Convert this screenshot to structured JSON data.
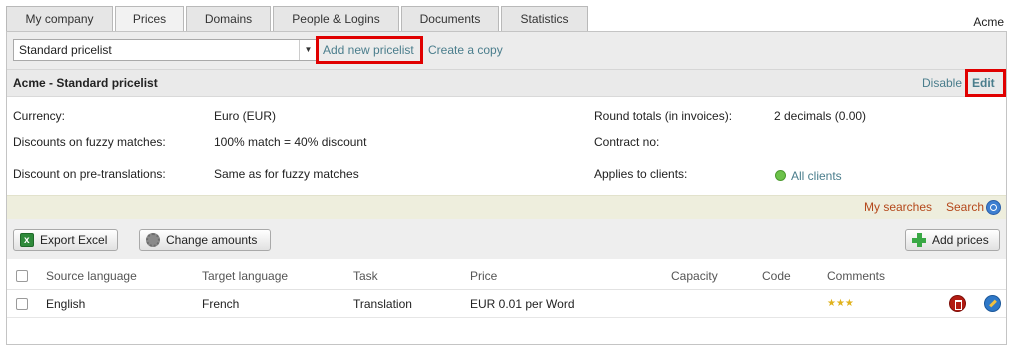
{
  "tabs": [
    {
      "label": "My company"
    },
    {
      "label": "Prices"
    },
    {
      "label": "Domains"
    },
    {
      "label": "People & Logins"
    },
    {
      "label": "Documents"
    },
    {
      "label": "Statistics"
    }
  ],
  "active_tab": "Prices",
  "company_name": "Acme",
  "pricelist_toolbar": {
    "selected_pricelist": "Standard pricelist",
    "add_new_label": "Add new pricelist",
    "create_copy_label": "Create a copy"
  },
  "pricelist_header": {
    "title": "Acme - Standard pricelist",
    "disable_label": "Disable",
    "edit_label": "Edit"
  },
  "details": {
    "currency_label": "Currency:",
    "currency_value": "Euro (EUR)",
    "fuzzy_label": "Discounts on fuzzy matches:",
    "fuzzy_value": "100% match = 40% discount",
    "pretranslation_label": "Discount on pre-translations:",
    "pretranslation_value": "Same as for fuzzy matches",
    "round_label": "Round totals (in invoices):",
    "round_value": "2 decimals (0.00)",
    "contract_label": "Contract no:",
    "contract_value": "",
    "applies_label": "Applies to clients:",
    "applies_value": "All clients"
  },
  "search_bar": {
    "my_searches_label": "My searches",
    "search_label": "Search"
  },
  "actions": {
    "export_label": "Export Excel",
    "change_amounts_label": "Change amounts",
    "add_prices_label": "Add prices"
  },
  "table": {
    "columns": [
      "Source language",
      "Target language",
      "Task",
      "Price",
      "Capacity",
      "Code",
      "Comments"
    ],
    "rows": [
      {
        "source": "English",
        "target": "French",
        "task": "Translation",
        "price": "EUR 0.01 per Word",
        "capacity": "",
        "code": "",
        "comments_rating": 3,
        "stars": "★★★"
      }
    ]
  },
  "colors": {
    "link": "#4a7d8c",
    "search_link": "#b4471a",
    "highlight_box": "#e00000",
    "all_clients_dot": "#6cc24a"
  }
}
